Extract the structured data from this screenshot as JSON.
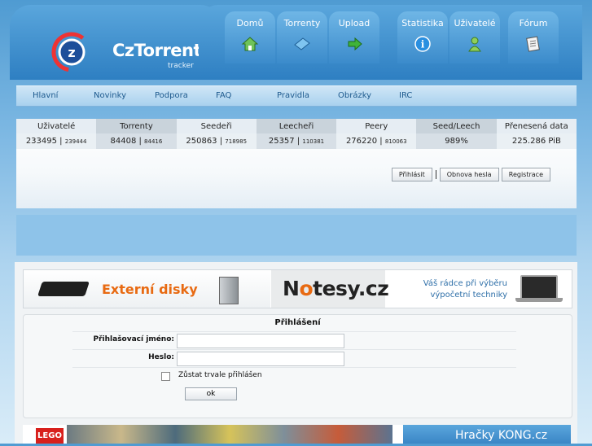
{
  "brand": {
    "name": "CzTorrent",
    "sub": "tracker"
  },
  "tabs": [
    {
      "label": "Domů",
      "icon": "house-icon"
    },
    {
      "label": "Torrenty",
      "icon": "disc-icon"
    },
    {
      "label": "Upload",
      "icon": "upload-arrow-icon"
    },
    {
      "label": "Statistika",
      "icon": "info-icon"
    },
    {
      "label": "Uživatelé",
      "icon": "user-icon"
    },
    {
      "label": "Fórum",
      "icon": "notepad-icon"
    }
  ],
  "nav": [
    "Hlavní",
    "Novinky",
    "Podpora",
    "FAQ",
    "Pravidla",
    "Obrázky",
    "IRC"
  ],
  "stats": {
    "headers": [
      "Uživatelé",
      "Torrenty",
      "Seedeři",
      "Leecheři",
      "Peery",
      "Seed/Leech",
      "Přenesená data"
    ],
    "values": [
      {
        "main": "233495",
        "sub": "239444"
      },
      {
        "main": "84408",
        "sub": "84416"
      },
      {
        "main": "250863",
        "sub": "718985"
      },
      {
        "main": "25357",
        "sub": "110381"
      },
      {
        "main": "276220",
        "sub": "810063"
      },
      {
        "main": "989%",
        "sub": ""
      },
      {
        "main": "225.286 PiB",
        "sub": ""
      }
    ]
  },
  "account_buttons": {
    "login": "Přihlásit",
    "recover": "Obnova hesla",
    "register": "Registrace"
  },
  "banner": {
    "left_text": "Externí disky",
    "notesy": "tesy.cz",
    "notesy_n": "N",
    "notesy_o": "o",
    "tagline_1": "Váš rádce při výběru",
    "tagline_2": "výpočetní techniky"
  },
  "login_form": {
    "title": "Přihlášení",
    "username_label": "Přihlašovací jméno:",
    "password_label": "Heslo:",
    "remember_label": "Zůstat trvale přihlášen",
    "submit": "ok"
  },
  "banner2": {
    "lego": "LEGO",
    "kong": "Hračky KONG.cz"
  }
}
